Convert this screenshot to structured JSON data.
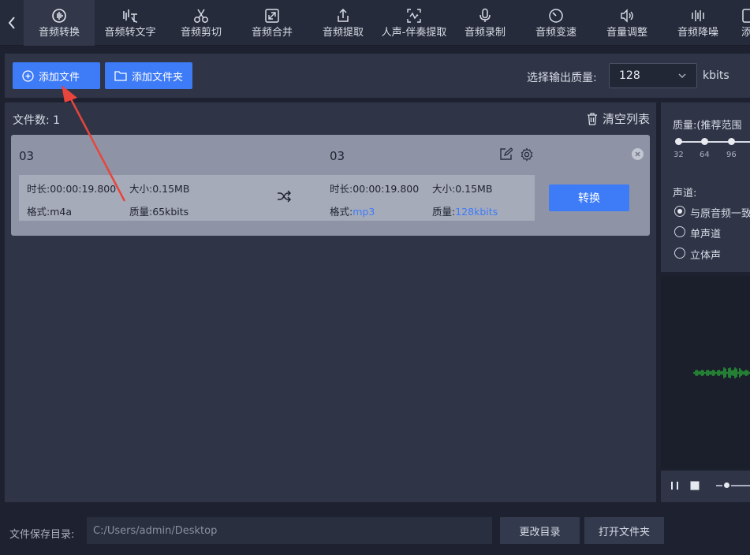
{
  "toolbar": {
    "items": [
      {
        "label": "音频转换",
        "icon": "audio-convert-icon"
      },
      {
        "label": "音频转文字",
        "icon": "speech-to-text-icon"
      },
      {
        "label": "音频剪切",
        "icon": "scissors-icon"
      },
      {
        "label": "音频合并",
        "icon": "merge-icon"
      },
      {
        "label": "音频提取",
        "icon": "extract-icon"
      },
      {
        "label": "人声-伴奏提取",
        "icon": "vocal-icon"
      },
      {
        "label": "音频录制",
        "icon": "microphone-icon"
      },
      {
        "label": "音频变速",
        "icon": "speed-icon"
      },
      {
        "label": "音量调整",
        "icon": "volume-icon"
      },
      {
        "label": "音频降噪",
        "icon": "denoise-icon"
      },
      {
        "label": "添",
        "icon": "more-icon"
      }
    ]
  },
  "actions": {
    "add_file": "添加文件",
    "add_folder": "添加文件夹",
    "quality_label": "选择输出质量:",
    "quality_value": "128",
    "quality_unit": "kbits"
  },
  "list": {
    "file_count_label": "文件数:",
    "file_count": "1",
    "clear_label": "清空列表"
  },
  "file": {
    "src_name": "03",
    "dst_name": "03",
    "src": {
      "duration_label": "时长:",
      "duration": "00:00:19.800",
      "size_label": "大小:",
      "size": "0.15MB",
      "format_label": "格式:",
      "format": "m4a",
      "quality_label": "质量:",
      "quality": "65kbits"
    },
    "dst": {
      "duration_label": "时长:",
      "duration": "00:00:19.800",
      "size_label": "大小:",
      "size": "0.15MB",
      "format_label": "格式:",
      "format": "mp3",
      "quality_label": "质量:",
      "quality": "128kbits"
    },
    "convert": "转换"
  },
  "right": {
    "quality_title": "质量:(推荐范围",
    "ticks": [
      "32",
      "64",
      "96"
    ],
    "channel_title": "声道:",
    "channels": [
      {
        "label": "与原音频一致",
        "checked": true
      },
      {
        "label": "单声道",
        "checked": false
      },
      {
        "label": "立体声",
        "checked": false
      }
    ]
  },
  "bottom": {
    "save_label": "文件保存目录:",
    "save_path": "C:/Users/admin/Desktop",
    "change_dir": "更改目录",
    "open_folder": "打开文件夹"
  },
  "colors": {
    "accent": "#3d7bf7",
    "annotation_arrow": "#e8453c",
    "waveform": "#2bbf3a"
  }
}
